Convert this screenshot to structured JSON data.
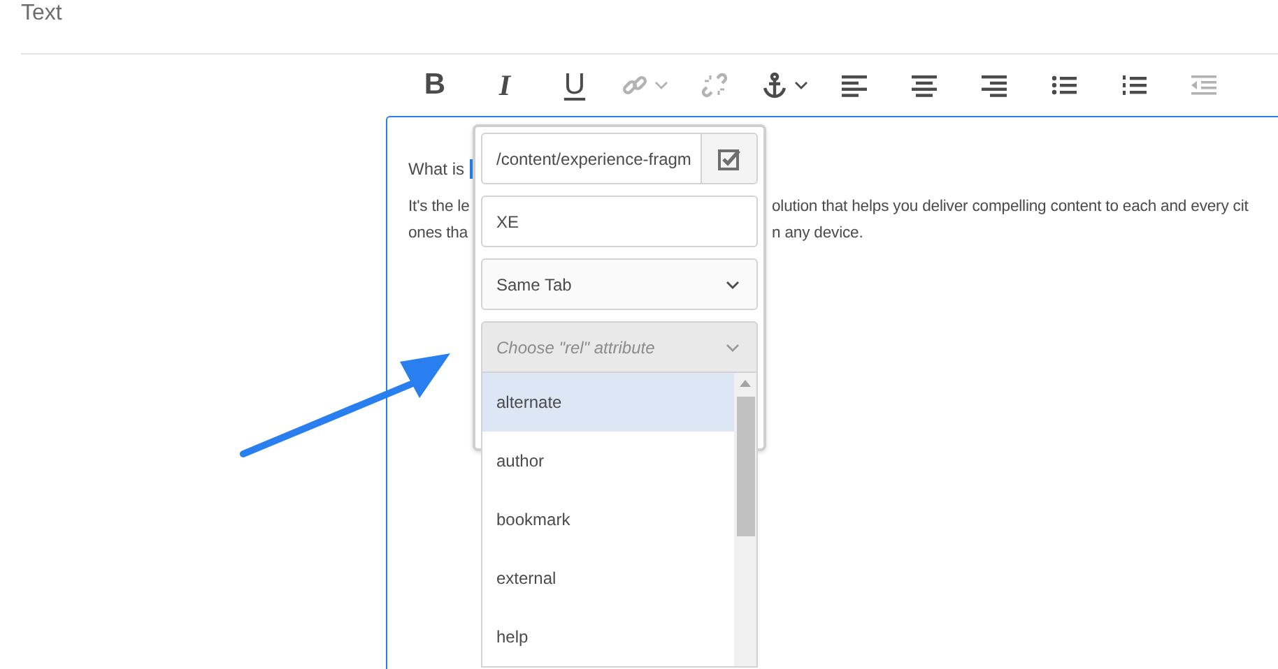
{
  "field_label": "Text",
  "toolbar": [
    {
      "kind": "bold",
      "label": "B",
      "disabled": false
    },
    {
      "kind": "italic",
      "label": "I",
      "disabled": false
    },
    {
      "kind": "underline",
      "label": "U",
      "disabled": false
    },
    {
      "kind": "link",
      "disabled": true,
      "dropdown": true
    },
    {
      "kind": "unlink",
      "disabled": true
    },
    {
      "kind": "anchor",
      "disabled": false,
      "dropdown": true
    },
    {
      "kind": "align-left",
      "disabled": false
    },
    {
      "kind": "align-center",
      "disabled": false
    },
    {
      "kind": "align-right",
      "disabled": false
    },
    {
      "kind": "bullet-list",
      "disabled": false
    },
    {
      "kind": "numbered-list",
      "disabled": false
    },
    {
      "kind": "outdent",
      "disabled": true
    }
  ],
  "editor": {
    "heading_start": "What is",
    "selection": true,
    "paragraph_left": [
      "It's the le",
      "ones tha"
    ],
    "paragraph_right": [
      "olution that helps you deliver compelling content to each and every cit",
      "n any device."
    ]
  },
  "link_dialog": {
    "path": "/content/experience-fragm",
    "title": "XE",
    "target": "Same Tab",
    "rel": {
      "placeholder": "Choose \"rel\" attribute",
      "expanded": true,
      "options": [
        {
          "label": "alternate",
          "selected": true
        },
        {
          "label": "author",
          "selected": false
        },
        {
          "label": "bookmark",
          "selected": false
        },
        {
          "label": "external",
          "selected": false
        },
        {
          "label": "help",
          "selected": false
        }
      ]
    }
  }
}
